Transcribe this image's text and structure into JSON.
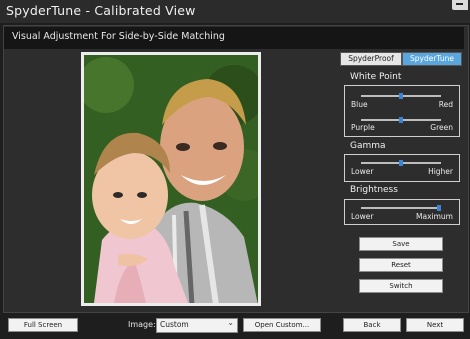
{
  "window": {
    "title": "SpyderTune - Calibrated View",
    "subtitle": "Visual Adjustment For Side-by-Side Matching"
  },
  "toggle": {
    "left_label": "SpyderProof",
    "right_label": "SpyderTune",
    "active": "SpyderTune"
  },
  "white_point": {
    "title": "White Point",
    "slider1": {
      "min_label": "Blue",
      "max_label": "Red",
      "value": 0.5
    },
    "slider2": {
      "min_label": "Purple",
      "max_label": "Green",
      "value": 0.5
    }
  },
  "gamma": {
    "title": "Gamma",
    "slider": {
      "min_label": "Lower",
      "max_label": "Higher",
      "value": 0.5
    }
  },
  "brightness": {
    "title": "Brightness",
    "slider": {
      "min_label": "Lower",
      "max_label": "Maximum",
      "value": 0.97
    }
  },
  "actions": {
    "save": "Save",
    "reset": "Reset",
    "switch": "Switch"
  },
  "bottom": {
    "full_screen": "Full Screen",
    "image_label": "Image:",
    "image_value": "Custom",
    "open_custom": "Open Custom...",
    "back": "Back",
    "next": "Next"
  },
  "colors": {
    "accent": "#5aa7e0",
    "slider_thumb": "#3a86d6"
  },
  "icons": {
    "minimize": "minimize-icon",
    "dropdown": "chevron-down-icon"
  }
}
